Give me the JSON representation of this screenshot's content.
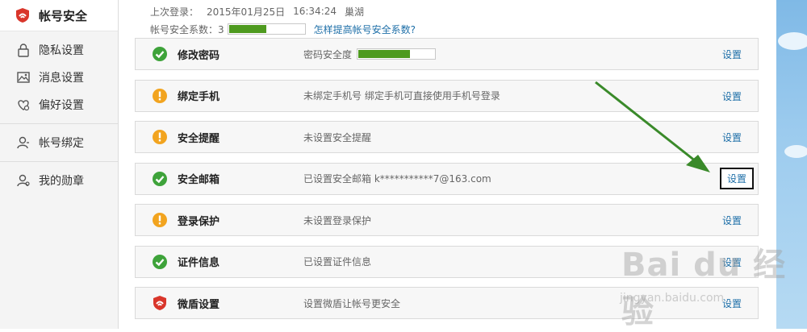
{
  "sidebar": {
    "title": "帐号安全",
    "group1": [
      {
        "label": "隐私设置",
        "icon": "lock-icon"
      },
      {
        "label": "消息设置",
        "icon": "image-icon"
      },
      {
        "label": "偏好设置",
        "icon": "heart-gear-icon"
      }
    ],
    "group2": [
      {
        "label": "帐号绑定",
        "icon": "user-icon"
      }
    ],
    "group3": [
      {
        "label": "我的勋章",
        "icon": "user-badge-icon"
      }
    ]
  },
  "header": {
    "last_login_label": "上次登录：",
    "last_login_date": "2015年01月25日",
    "last_login_time": "16:34:24",
    "last_login_location": "巢湖",
    "score_label": "帐号安全系数：3",
    "score_fraction": 0.5,
    "improve_link": "怎样提高帐号安全系数?"
  },
  "items": [
    {
      "status": "ok",
      "name": "修改密码",
      "desc": "密码安全度",
      "has_bar": true,
      "bar_fraction": 0.68,
      "action": "设置"
    },
    {
      "status": "warn",
      "name": "绑定手机",
      "desc": "未绑定手机号 绑定手机可直接使用手机号登录",
      "action": "设置"
    },
    {
      "status": "warn",
      "name": "安全提醒",
      "desc": "未设置安全提醒",
      "action": "设置"
    },
    {
      "status": "ok",
      "name": "安全邮箱",
      "desc": "已设置安全邮箱 k***********7@163.com",
      "action": "设置",
      "highlight": true
    },
    {
      "status": "warn",
      "name": "登录保护",
      "desc": "未设置登录保护",
      "action": "设置"
    },
    {
      "status": "ok",
      "name": "证件信息",
      "desc": "已设置证件信息",
      "action": "设置"
    },
    {
      "status": "shield",
      "name": "微盾设置",
      "desc": "设置微盾让帐号更安全",
      "action": "设置"
    }
  ],
  "colors": {
    "ok": "#3ea33a",
    "warn": "#f2a41f",
    "shield": "#d9362b",
    "link": "#1e6fa8",
    "bar": "#4e9a1f",
    "arrow": "#3a8a2a"
  },
  "watermark": {
    "brand": "Bai du 经验",
    "url": "jingyan.baidu.com"
  }
}
